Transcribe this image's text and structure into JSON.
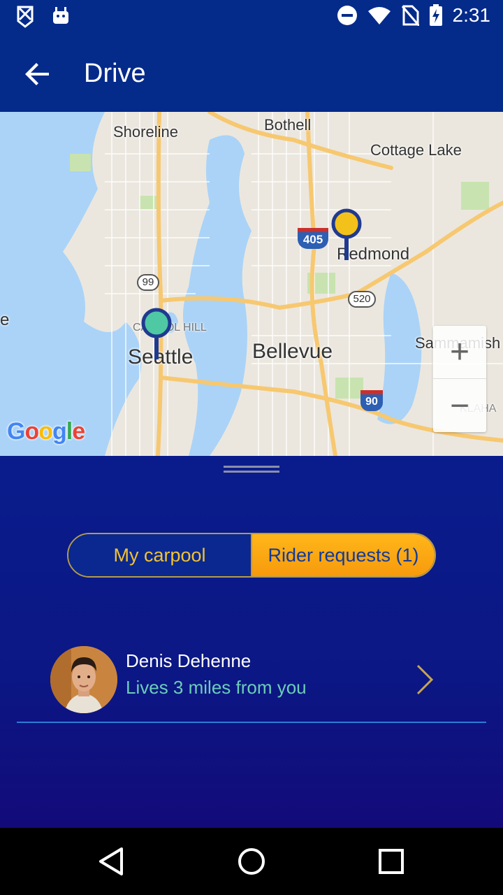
{
  "status_bar": {
    "time": "2:31",
    "icons": [
      "notification-icon",
      "android-icon",
      "do-not-disturb-icon",
      "wifi-icon",
      "no-sim-icon",
      "battery-charging-icon"
    ]
  },
  "app_bar": {
    "title": "Drive",
    "back_icon": "arrow-back-icon"
  },
  "map": {
    "labels": {
      "shoreline": "Shoreline",
      "bothell": "Bothell",
      "cottage_lake": "Cottage Lake",
      "redmond": "Redmond",
      "capitol_hill": "CAPITOL HILL",
      "seattle": "Seattle",
      "bellevue": "Bellevue",
      "sammamish": "Sammamish",
      "klahanie": "KLAHA",
      "partial_left": "e"
    },
    "shields": {
      "i405": "405",
      "sr99": "99",
      "sr520": "520",
      "i90": "90"
    },
    "google": "Google",
    "zoom_in": "+",
    "zoom_out": "−",
    "colors": {
      "water": "#aad3f7",
      "land": "#ebe7df",
      "highway": "#f7c870",
      "pin_origin": "#4fc8a4",
      "pin_destination": "#f2c21b",
      "pin_stroke": "#1f3a8f"
    }
  },
  "tabs": {
    "my_carpool": "My carpool",
    "rider_requests": "Rider requests (1)",
    "selected": "Rider requests (1)"
  },
  "requests": [
    {
      "name": "Denis Dehenne",
      "subtitle": "Lives 3 miles from you"
    }
  ],
  "colors": {
    "app_bar": "#042b8a",
    "accent": "#f7a415",
    "accent_text": "#f1c232",
    "subtitle": "#6ccdb7",
    "divider": "#2d7bd8"
  },
  "nav_bar": {
    "icons": [
      "back-triangle-icon",
      "home-circle-icon",
      "recents-square-icon"
    ]
  }
}
